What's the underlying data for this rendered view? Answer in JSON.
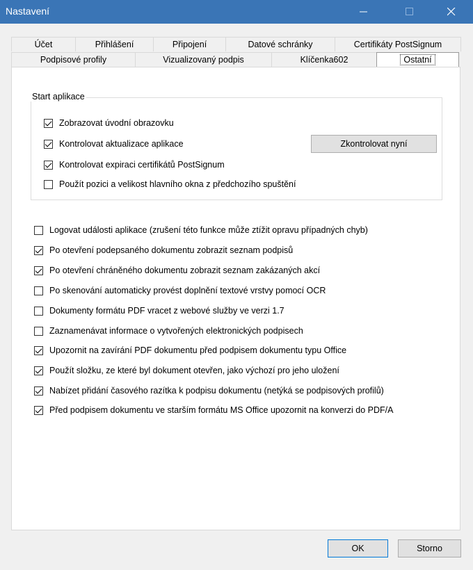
{
  "window": {
    "title": "Nastavení"
  },
  "tabs_row1": [
    "Účet",
    "Přihlášení",
    "Připojení",
    "Datové schránky",
    "Certifikáty PostSignum"
  ],
  "tabs_row2": [
    "Podpisové profily",
    "Vizualizovaný podpis",
    "Klíčenka602",
    "Ostatní"
  ],
  "group": {
    "title": "Start aplikace",
    "items": [
      {
        "label": "Zobrazovat úvodní obrazovku",
        "checked": true
      },
      {
        "label": "Kontrolovat aktualizace aplikace",
        "checked": true
      },
      {
        "label": "Kontrolovat expiraci certifikátů PostSignum",
        "checked": true
      },
      {
        "label": "Použít pozici a velikost hlavního okna z předchozího spuštění",
        "checked": false
      }
    ],
    "check_now_button": "Zkontrolovat nyní"
  },
  "options": [
    {
      "label": "Logovat události aplikace (zrušení této funkce může ztížit opravu případných chyb)",
      "checked": false
    },
    {
      "label": "Po otevření podepsaného dokumentu zobrazit seznam podpisů",
      "checked": true
    },
    {
      "label": "Po otevření chráněného dokumentu zobrazit seznam zakázaných akcí",
      "checked": true
    },
    {
      "label": "Po skenování automaticky provést doplnění textové vrstvy pomocí OCR",
      "checked": false
    },
    {
      "label": "Dokumenty formátu PDF vracet z webové služby ve verzi 1.7",
      "checked": false
    },
    {
      "label": "Zaznamenávat informace o vytvořených elektronických podpisech",
      "checked": false
    },
    {
      "label": "Upozornit na zavírání PDF dokumentu před podpisem dokumentu typu Office",
      "checked": true
    },
    {
      "label": "Použít složku, ze které byl dokument otevřen, jako výchozí pro jeho uložení",
      "checked": true
    },
    {
      "label": "Nabízet přidání časového razítka k podpisu dokumentu (netýká se podpisových profilů)",
      "checked": true
    },
    {
      "label": "Před podpisem dokumentu ve starším formátu MS Office upozornit na konverzi do PDF/A",
      "checked": true
    }
  ],
  "buttons": {
    "ok": "OK",
    "cancel": "Storno"
  },
  "colors": {
    "titlebar": "#3a75b6"
  }
}
